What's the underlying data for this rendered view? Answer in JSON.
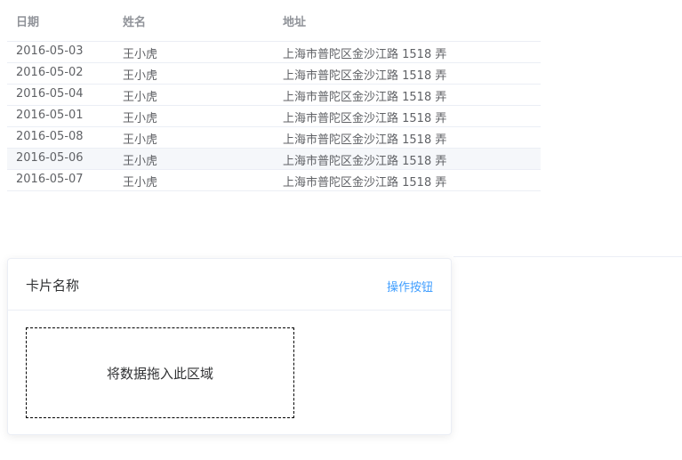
{
  "table": {
    "headers": [
      "日期",
      "姓名",
      "地址"
    ],
    "rows": [
      {
        "date": "2016-05-03",
        "name": "王小虎",
        "address": "上海市普陀区金沙江路 1518 弄"
      },
      {
        "date": "2016-05-02",
        "name": "王小虎",
        "address": "上海市普陀区金沙江路 1518 弄"
      },
      {
        "date": "2016-05-04",
        "name": "王小虎",
        "address": "上海市普陀区金沙江路 1518 弄"
      },
      {
        "date": "2016-05-01",
        "name": "王小虎",
        "address": "上海市普陀区金沙江路 1518 弄"
      },
      {
        "date": "2016-05-08",
        "name": "王小虎",
        "address": "上海市普陀区金沙江路 1518 弄"
      },
      {
        "date": "2016-05-06",
        "name": "王小虎",
        "address": "上海市普陀区金沙江路 1518 弄"
      },
      {
        "date": "2016-05-07",
        "name": "王小虎",
        "address": "上海市普陀区金沙江路 1518 弄"
      }
    ]
  },
  "card": {
    "title": "卡片名称",
    "action_label": "操作按钮",
    "drop_zone_text": "将数据拖入此区域"
  },
  "colors": {
    "accent": "#409eff",
    "header_text": "#909399",
    "body_text": "#606266",
    "border": "#ebeef5",
    "hover_row": "#f5f7fa"
  }
}
